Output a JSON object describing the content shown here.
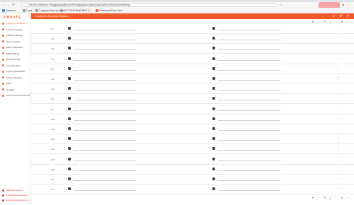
{
  "browser": {
    "url": "chrome-extension://ehagpgvaldgjfhoohnfkbmjkpjpgldo/options/app/index.html#/DownSettings",
    "bookmarks": [
      {
        "label": "Сервисы",
        "color": "#4a90d9"
      },
      {
        "label": "Load",
        "color": "#9aa0a6"
      },
      {
        "label": "Содержи Бунтарская...",
        "color": "#9aa0a6"
      },
      {
        "label": "БЕСПЛАТНЫЙ ВЕБ С...",
        "color": "#9aa0a6"
      },
      {
        "label": "Download Free Vect...",
        "color": "#f36b3a"
      }
    ]
  },
  "sidebar": {
    "logo": "VIBRATE",
    "items": [
      {
        "label": "Intelligent Notification",
        "active": true
      },
      {
        "label": "Location Settings"
      },
      {
        "label": "Vibration Settings"
      },
      {
        "label": "Down Settings"
      },
      {
        "label": "Alarm Notification"
      },
      {
        "label": "Waiting Mode"
      },
      {
        "label": "Device Setting"
      },
      {
        "label": "Launcher Apps"
      },
      {
        "label": "Lighting Notification"
      },
      {
        "label": "Shortcut Buttons"
      },
      {
        "label": "Slider"
      },
      {
        "label": "Security"
      },
      {
        "label": "Control Reminder Period"
      }
    ],
    "footer": [
      {
        "label": "Help and Support"
      },
      {
        "label": "Feedback and Contact"
      },
      {
        "label": "Settings and Extension"
      }
    ]
  },
  "header": {
    "title": "Customise Shortcut Buttons"
  },
  "rows": [
    {
      "num": "1/1",
      "value": ""
    },
    {
      "num": "2/1",
      "value": ""
    },
    {
      "num": "3/1",
      "value": ""
    },
    {
      "num": "4/1",
      "value": ""
    },
    {
      "num": "5/1",
      "value": ""
    },
    {
      "num": "6/1",
      "value": ""
    },
    {
      "num": "7/1",
      "value": ""
    },
    {
      "num": "8/1",
      "value": ""
    },
    {
      "num": "9/1",
      "value": ""
    },
    {
      "num": "10/1",
      "value": ""
    },
    {
      "num": "11/1",
      "value": ""
    },
    {
      "num": "12/1",
      "value": ""
    },
    {
      "num": "13/1",
      "value": ""
    },
    {
      "num": "14/1",
      "value": ""
    },
    {
      "num": "15/1",
      "value": ""
    },
    {
      "num": "16/1",
      "value": ""
    },
    {
      "num": "17/1",
      "value": ""
    }
  ],
  "icons": {
    "header": [
      "maximize-icon",
      "settings-icon",
      "close-icon"
    ],
    "toolbar": [
      "first-icon",
      "prev-icon",
      "refresh-icon",
      "download-icon",
      "next-icon",
      "last-icon",
      "more-icon"
    ]
  }
}
